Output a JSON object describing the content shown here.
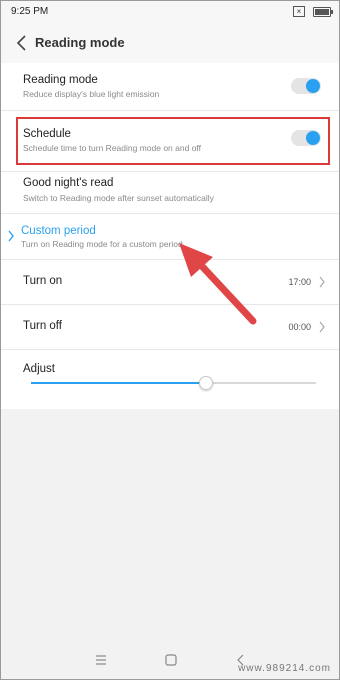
{
  "status": {
    "time": "9:25 PM"
  },
  "header": {
    "title": "Reading mode"
  },
  "rows": {
    "reading_mode": {
      "title": "Reading mode",
      "subtitle": "Reduce display's blue light emission",
      "toggle_on": true
    },
    "schedule": {
      "title": "Schedule",
      "subtitle": "Schedule time to turn Reading mode on and off",
      "toggle_on": true
    },
    "good_night": {
      "title": "Good night's read",
      "subtitle": "Switch to Reading mode after sunset automatically"
    },
    "custom_period": {
      "title": "Custom period",
      "subtitle": "Turn on Reading mode for a custom period",
      "selected": true
    },
    "turn_on": {
      "title": "Turn on",
      "value": "17:00"
    },
    "turn_off": {
      "title": "Turn off",
      "value": "00:00"
    },
    "adjust": {
      "title": "Adjust",
      "level": 0.61
    }
  },
  "colors": {
    "accent": "#2aa1f0",
    "highlight": "#d93a3a",
    "arrow": "#e04646"
  },
  "icons": {
    "back": "chevron-left-icon",
    "menu": "menu-icon",
    "home": "home-square-icon",
    "nav_back": "nav-back-icon"
  },
  "watermark": "www.989214.com"
}
